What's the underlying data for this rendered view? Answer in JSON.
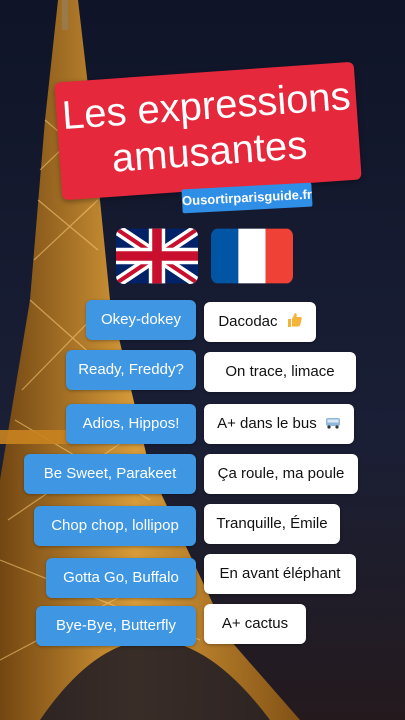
{
  "title": {
    "line1": "Les expressions",
    "line2": "amusantes"
  },
  "site": "Ousortirparisguide.fr",
  "flags": {
    "left": "uk-flag",
    "right": "france-flag"
  },
  "colors": {
    "title_bg": "#e5283b",
    "english_pill": "#3f97e4",
    "french_pill": "#ffffff",
    "badge": "#2f8ee5"
  },
  "expressions": [
    {
      "en": "Okey-dokey",
      "fr": "Dacodac",
      "fr_icon": "thumbs-up-icon"
    },
    {
      "en": "Ready, Freddy?",
      "fr": "On trace, limace"
    },
    {
      "en": "Adios, Hippos!",
      "fr": "A+ dans le bus",
      "fr_icon": "bus-icon"
    },
    {
      "en": "Be Sweet, Parakeet",
      "fr": "Ça roule, ma poule"
    },
    {
      "en": "Chop chop, lollipop",
      "fr": "Tranquille, Émile"
    },
    {
      "en": "Gotta Go, Buffalo",
      "fr": "En avant éléphant"
    },
    {
      "en": "Bye-Bye, Butterfly",
      "fr": "A+ cactus"
    }
  ]
}
